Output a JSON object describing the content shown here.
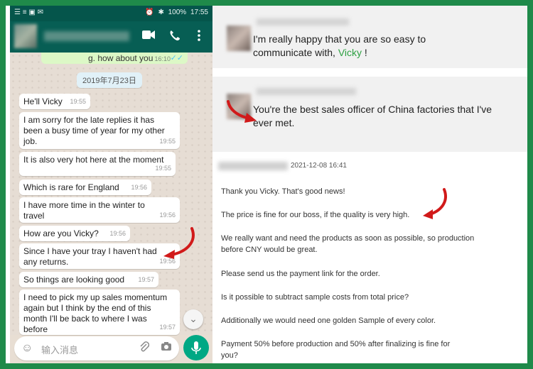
{
  "status_bar": {
    "left_icons": "☰ ≡ ▣ ✉",
    "battery": "100%",
    "time": "17:55"
  },
  "chat": {
    "prev_message": {
      "text": "g. how about you",
      "time": "16:10",
      "ticks": "✓✓"
    },
    "date_chip": "2019年7月23日",
    "messages": [
      {
        "text": "He'll Vicky",
        "time": "19:55"
      },
      {
        "text": "I am sorry for the late replies it has been a busy time of year for my other job.",
        "time": "19:55"
      },
      {
        "text": "It is also very hot here at the moment",
        "time": "19:55"
      },
      {
        "text": "Which is rare for England",
        "time": "19:56"
      },
      {
        "text": "I have more time in the winter to travel",
        "time": "19:56"
      },
      {
        "text": "How are you Vicky?",
        "time": "19:56"
      },
      {
        "text": "Since I have your tray I haven't had any returns.",
        "time": "19:56"
      },
      {
        "text": "So things are looking good",
        "time": "19:57"
      },
      {
        "text": "I need to pick my up sales momentum again but I think by the end of this month I'll be back to where I was before",
        "time": "19:57"
      }
    ],
    "input_placeholder": "输入消息"
  },
  "icons": {
    "video": "video-camera-icon",
    "call": "phone-icon",
    "menu": "more-vertical-icon",
    "emoji": "emoji-icon",
    "attach": "paperclip-icon",
    "camera": "camera-icon",
    "mic": "microphone-icon",
    "jump": "double-chevron-down-icon"
  },
  "colors": {
    "whatsapp_header": "#075e54",
    "highlight": "#2ea043",
    "arrow": "#d11a1a",
    "border": "#1f8a4a"
  },
  "reviews": {
    "card1": {
      "text_before": "I'm really happy that you are so easy to communicate with, ",
      "highlight": "Vicky",
      "text_after": " !"
    },
    "card2": {
      "text": "You're the best sales officer of China factories that I've ever met."
    }
  },
  "email": {
    "date": "2021-12-08 16:41",
    "paragraphs": [
      "Thank you Vicky. That's good news!",
      "The price is fine for our boss, if the quality is very high.",
      "We really want and need the products as soon as possible, so production before CNY would be great.",
      "Please send us the payment link for the order.",
      "Is it possible to subtract sample costs from total price?",
      "Additionally we would need one golden Sample of every color.",
      "Payment 50% before production and 50% after finalizing is fine for you?"
    ]
  }
}
